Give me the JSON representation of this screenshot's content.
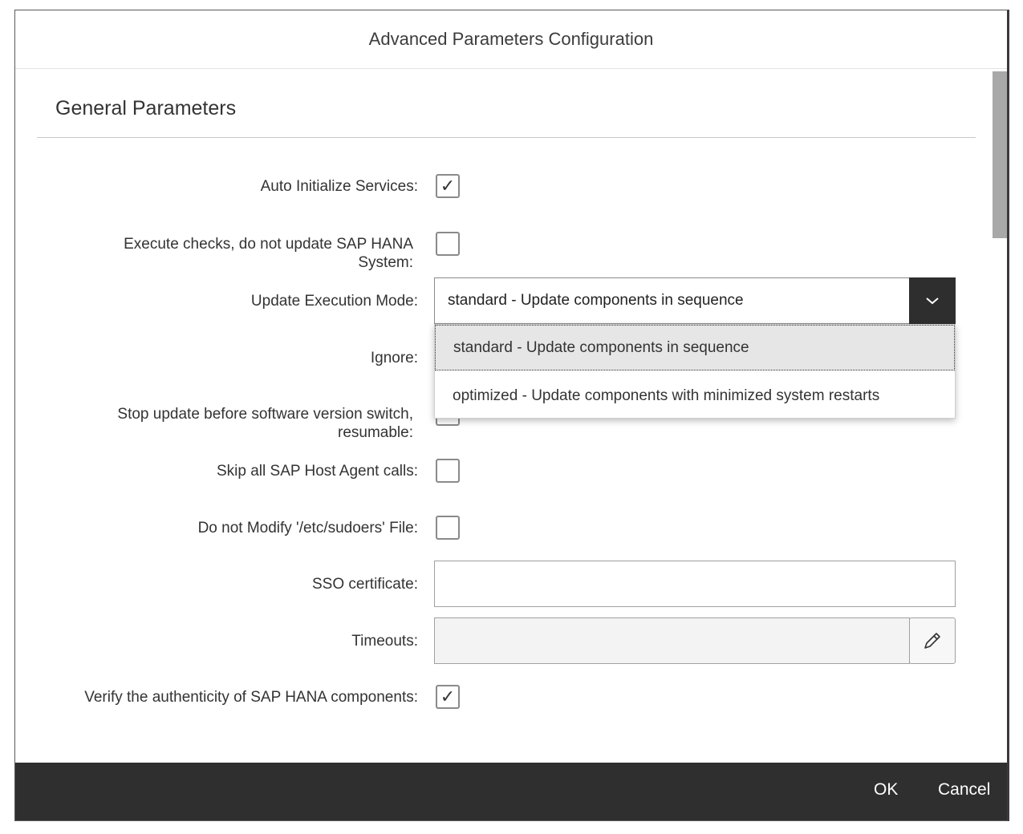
{
  "dialog": {
    "title": "Advanced Parameters Configuration",
    "section_title": "General Parameters"
  },
  "fields": {
    "auto_initialize": {
      "label": "Auto Initialize Services:",
      "checked": true
    },
    "execute_checks": {
      "label_line1": "Execute checks, do not update SAP HANA",
      "label_line2": "System:",
      "checked": false
    },
    "update_mode": {
      "label": "Update Execution Mode:",
      "value": "standard - Update components in sequence",
      "options": [
        "standard - Update components in sequence",
        "optimized - Update components with minimized system restarts"
      ]
    },
    "ignore": {
      "label": "Ignore:"
    },
    "stop_update": {
      "label_line1": "Stop update before software version switch,",
      "label_line2": "resumable:",
      "checked": false
    },
    "skip_host_agent": {
      "label": "Skip all SAP Host Agent calls:",
      "checked": false
    },
    "no_modify_sudoers": {
      "label": "Do not Modify '/etc/sudoers' File:",
      "checked": false
    },
    "sso_certificate": {
      "label": "SSO certificate:",
      "value": ""
    },
    "timeouts": {
      "label": "Timeouts:",
      "value": ""
    },
    "verify_authenticity": {
      "label": "Verify the authenticity of SAP HANA components:",
      "checked": true
    }
  },
  "footer": {
    "ok_label": "OK",
    "cancel_label": "Cancel"
  },
  "icons": {
    "check": "checkmark-icon",
    "dropdown": "chevron-down-icon",
    "edit": "pencil-icon"
  },
  "colors": {
    "footer_bg": "#2f2f2f",
    "dropdown_button_bg": "#2e2e2e",
    "selected_option_bg": "#e6e6e6"
  }
}
